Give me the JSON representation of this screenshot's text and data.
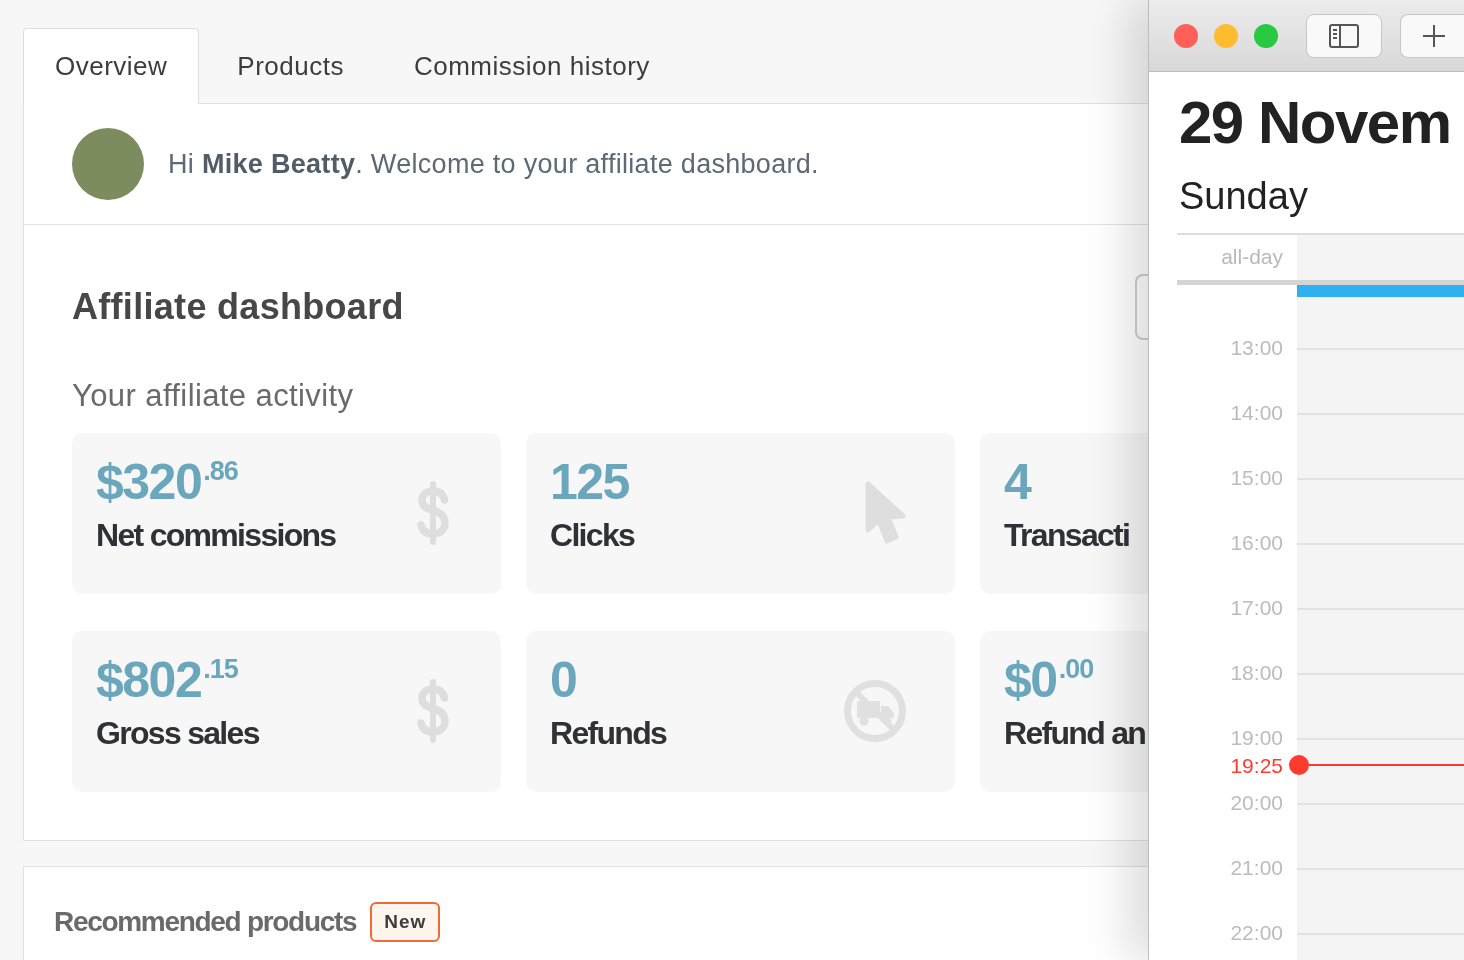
{
  "tabs": [
    {
      "label": "Overview",
      "selected": true
    },
    {
      "label": "Products",
      "selected": false
    },
    {
      "label": "Commission history",
      "selected": false
    }
  ],
  "greeting": {
    "text": "Hi **Mike Beatty**. Welcome to your affiliate dashboard."
  },
  "dashboard": {
    "heading": "Affiliate dashboard",
    "subheading": "Your affiliate activity",
    "stats": [
      {
        "kind": "money",
        "value": "$320",
        "fraction": ".86",
        "label": "Net commissions"
      },
      {
        "kind": "clicks",
        "value": "125",
        "label": "Clicks"
      },
      {
        "kind": "transactions",
        "value": "4",
        "label": "Transacti"
      },
      {
        "kind": "money",
        "value": "$802",
        "fraction": ".15",
        "label": "Gross sales"
      },
      {
        "kind": "refunds",
        "value": "0",
        "label": "Refunds"
      },
      {
        "kind": "refund-amount",
        "value": "$0",
        "fraction": ".00",
        "label": "Refund an"
      }
    ]
  },
  "recommended": {
    "heading": "Recommended products",
    "badge": "New"
  },
  "calendar": {
    "date": "29 Novem",
    "weekday": "Sunday",
    "all_day_label": "all-day",
    "events": [
      {
        "color": "#2fb0f0"
      }
    ],
    "hours": [
      {
        "kind": "hour",
        "label": "13:00"
      },
      {
        "kind": "hour",
        "label": "14:00"
      },
      {
        "kind": "hour",
        "label": "15:00"
      },
      {
        "kind": "hour",
        "label": "16:00"
      },
      {
        "kind": "hour",
        "label": "17:00"
      },
      {
        "kind": "hour",
        "label": "18:00"
      },
      {
        "kind": "hour",
        "label": "19:00"
      },
      {
        "kind": "now",
        "label": "19:25"
      },
      {
        "kind": "hour",
        "label": "20:00"
      },
      {
        "kind": "hour",
        "label": "21:00"
      },
      {
        "kind": "hour",
        "label": "22:00"
      }
    ]
  }
}
